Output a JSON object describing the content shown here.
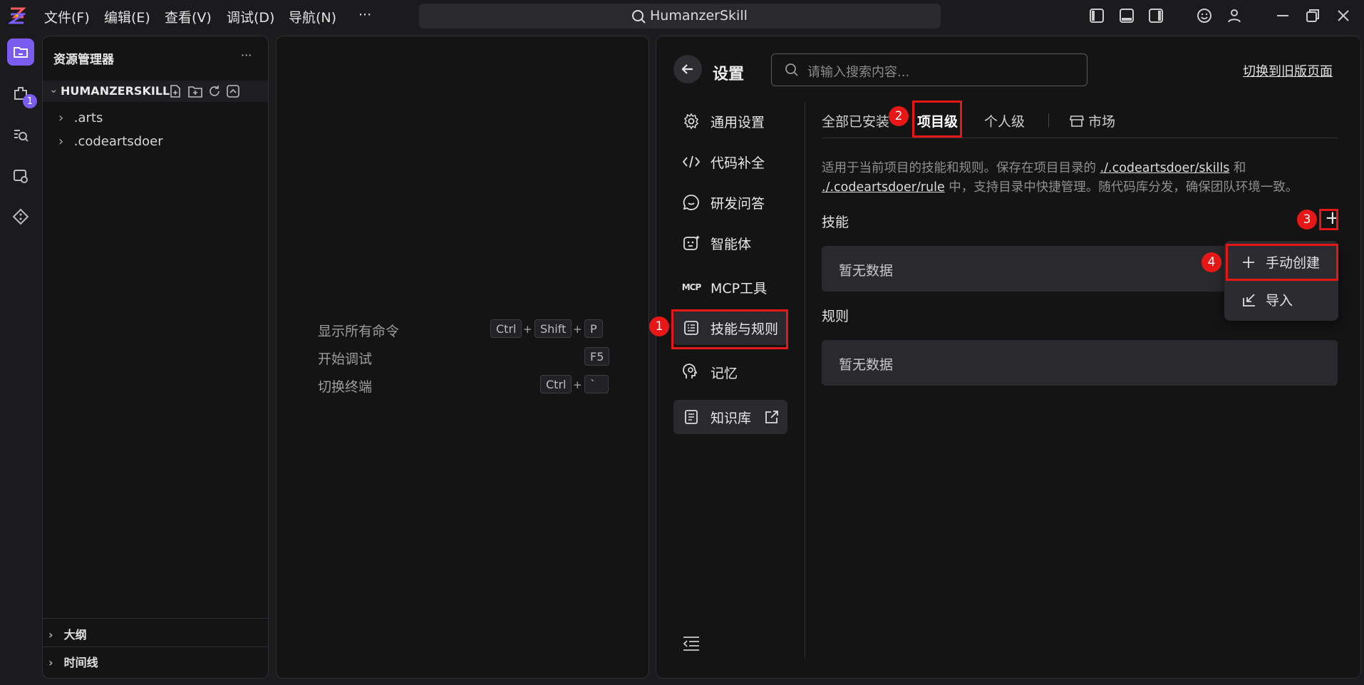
{
  "menu": [
    "文件(F)",
    "编辑(E)",
    "查看(V)",
    "调试(D)",
    "导航(N)",
    "···"
  ],
  "search": {
    "text": "HumanzerSkill"
  },
  "activity_badge": "1",
  "explorer": {
    "title": "资源管理器",
    "more": "···",
    "root": "HUMANZERSKILL",
    "items": [
      ".arts",
      ".codeartsdoer"
    ],
    "bottom_sections": [
      "大纲",
      "时间线"
    ]
  },
  "editor": {
    "commands": [
      {
        "label": "显示所有命令",
        "keys": [
          "Ctrl",
          "Shift",
          "P"
        ]
      },
      {
        "label": "开始调试",
        "keys": [
          "F5"
        ]
      },
      {
        "label": "切换终端",
        "keys": [
          "Ctrl",
          "`"
        ]
      }
    ],
    "plus": "+"
  },
  "settings": {
    "title": "设置",
    "search_placeholder": "请输入搜索内容...",
    "switch_old": "切换到旧版页面",
    "nav": [
      {
        "label": "通用设置",
        "icon": "gear-icon"
      },
      {
        "label": "代码补全",
        "icon": "code-icon"
      },
      {
        "label": "研发问答",
        "icon": "chat-icon"
      },
      {
        "label": "智能体",
        "icon": "agent-icon"
      },
      {
        "label": "MCP工具",
        "icon": "mcp-icon"
      },
      {
        "label": "技能与规则",
        "icon": "rules-icon"
      },
      {
        "label": "记忆",
        "icon": "memory-icon"
      },
      {
        "label": "知识库",
        "icon": "knowledge-icon"
      }
    ],
    "tabs": [
      "全部已安装",
      "项目级",
      "个人级",
      "市场"
    ],
    "desc_1": "适用于当前项目的技能和规则。保存在项目目录的 ",
    "link_skills": "./.codeartsdoer/skills",
    "desc_and": " 和",
    "link_rule": "./.codeartsdoer/rule",
    "desc_2": " 中，支持目录中快捷管理。随代码库分发，确保团队环境一致。",
    "skills_label": "技能",
    "rules_label": "规则",
    "empty": "暂无数据",
    "add": "+",
    "dropdown": [
      "手动创建",
      "导入"
    ]
  },
  "annotations": [
    "1",
    "2",
    "3",
    "4"
  ],
  "colors": {
    "accent": "#8b5cf6",
    "highlight": "#e81717",
    "background": "#141415"
  }
}
